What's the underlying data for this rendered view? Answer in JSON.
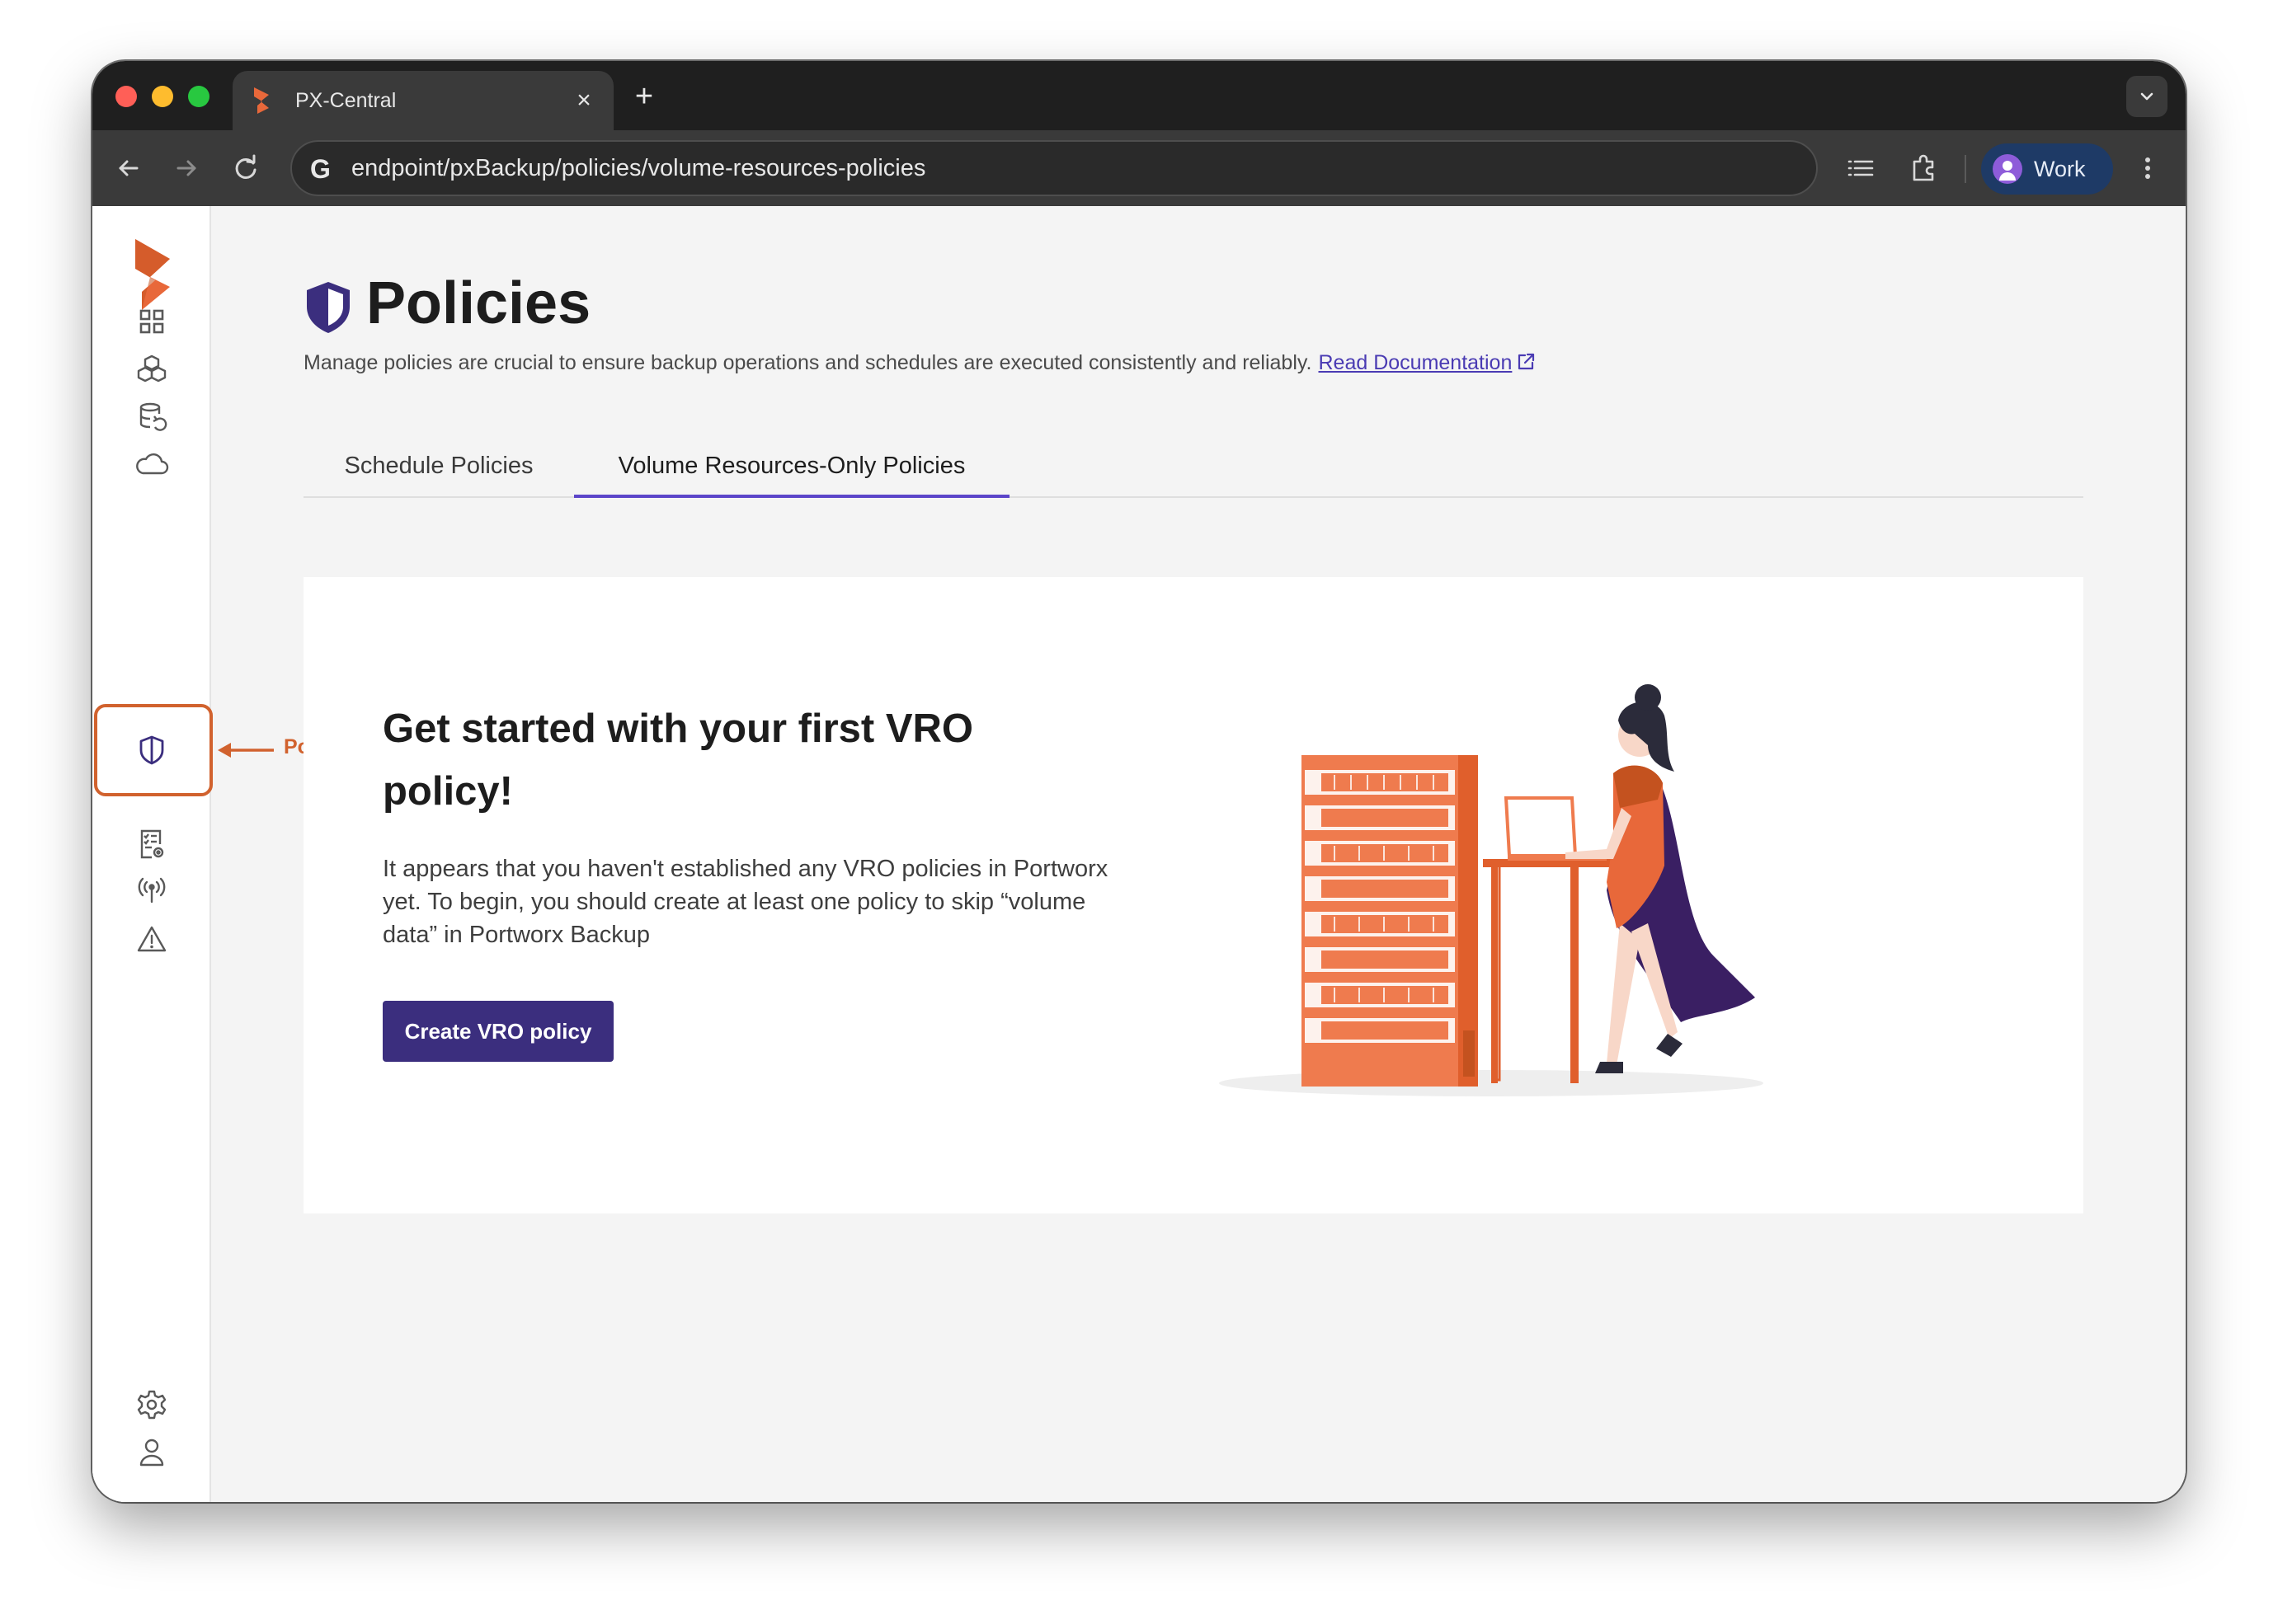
{
  "browser": {
    "tab_title": "PX-Central",
    "tab_close": "×",
    "new_tab": "+",
    "url": "endpoint/pxBackup/policies/volume-resources-policies",
    "search_engine_glyph": "G",
    "profile_label": "Work"
  },
  "sidebar": {
    "items": [
      {
        "icon": "dashboard-grid-icon"
      },
      {
        "icon": "clusters-cubes-icon"
      },
      {
        "icon": "backup-database-icon"
      },
      {
        "icon": "cloud-icon"
      },
      {
        "icon": "policies-shield-icon",
        "active": true
      },
      {
        "icon": "rules-checklist-icon"
      },
      {
        "icon": "signal-antenna-icon"
      },
      {
        "icon": "alert-warning-icon"
      }
    ],
    "bottom": [
      {
        "icon": "settings-gear-icon"
      },
      {
        "icon": "user-profile-icon"
      }
    ],
    "callout_label": "Policies"
  },
  "page": {
    "title": "Policies",
    "description": "Manage policies are crucial to ensure backup operations and schedules are executed consistently and reliably.",
    "doc_link": "Read Documentation"
  },
  "tabs": [
    {
      "label": "Schedule Policies",
      "active": false
    },
    {
      "label": "Volume Resources-Only Policies",
      "active": true
    }
  ],
  "empty_state": {
    "heading": "Get started with your first VRO policy!",
    "body": "It appears that you haven't established any VRO policies in Portworx yet. To begin, you should create at least one policy to skip “volume data” in Portworx Backup",
    "button": "Create VRO policy"
  },
  "colors": {
    "brand_orange": "#e8683a",
    "accent_purple": "#3b2e7e",
    "link_purple": "#4a3bb3",
    "callout_orange": "#d1622e"
  }
}
